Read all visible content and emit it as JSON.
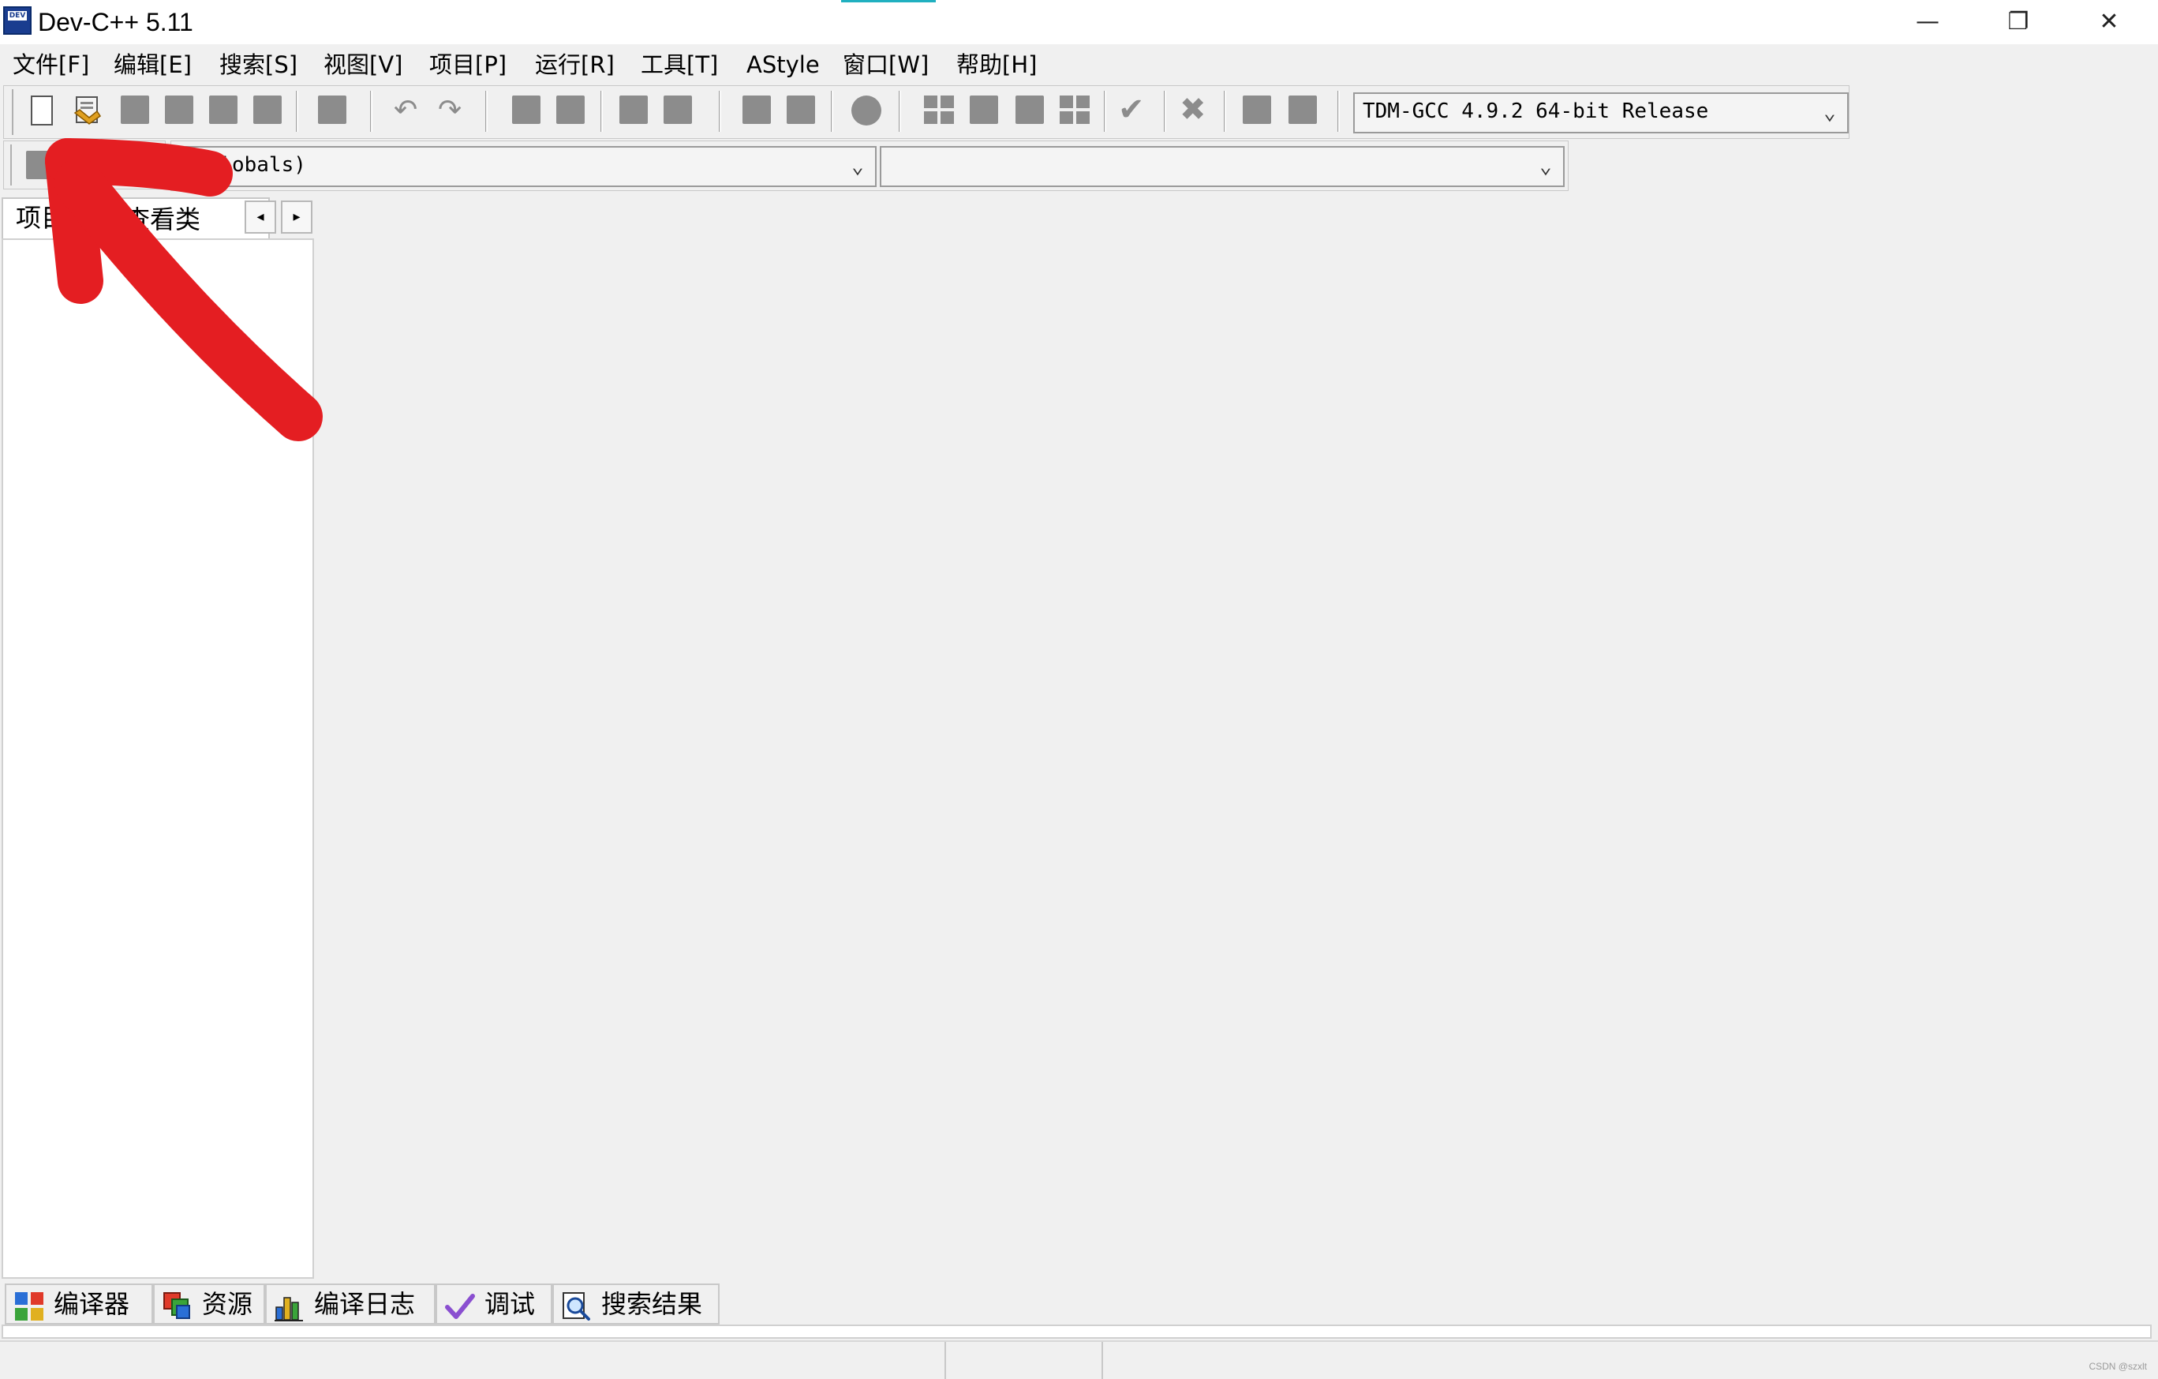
{
  "window": {
    "title": "Dev-C++ 5.11",
    "app_icon_text": "DEV",
    "minimize_glyph": "—",
    "restore_glyph": "❐",
    "close_glyph": "✕"
  },
  "menu": [
    {
      "label": "文件[F]"
    },
    {
      "label": "编辑[E]"
    },
    {
      "label": "搜索[S]"
    },
    {
      "label": "视图[V]"
    },
    {
      "label": "项目[P]"
    },
    {
      "label": "运行[R]"
    },
    {
      "label": "工具[T]"
    },
    {
      "label": "AStyle"
    },
    {
      "label": "窗口[W]"
    },
    {
      "label": "帮助[H]"
    }
  ],
  "toolbar": {
    "compiler_select": "TDM-GCC 4.9.2 64-bit Release",
    "scope_select": "(globals)",
    "member_select": "",
    "dropdown_glyph": "⌄"
  },
  "left_panel": {
    "tab_project": "项目",
    "tab_classes": "查看类",
    "scroll_left": "◂",
    "scroll_right": "▸"
  },
  "bottom_tabs": [
    {
      "label": "编译器",
      "icon": "compiler-grid-icon"
    },
    {
      "label": "资源",
      "icon": "resources-icon"
    },
    {
      "label": "编译日志",
      "icon": "compile-log-chart-icon"
    },
    {
      "label": "调试",
      "icon": "debug-check-icon"
    },
    {
      "label": "搜索结果",
      "icon": "search-results-icon"
    }
  ],
  "watermark": "CSDN @szxlt",
  "colors": {
    "annotation_red": "#e41e22",
    "menu_bg": "#f0f0f0",
    "panel_bg": "#ffffff"
  }
}
